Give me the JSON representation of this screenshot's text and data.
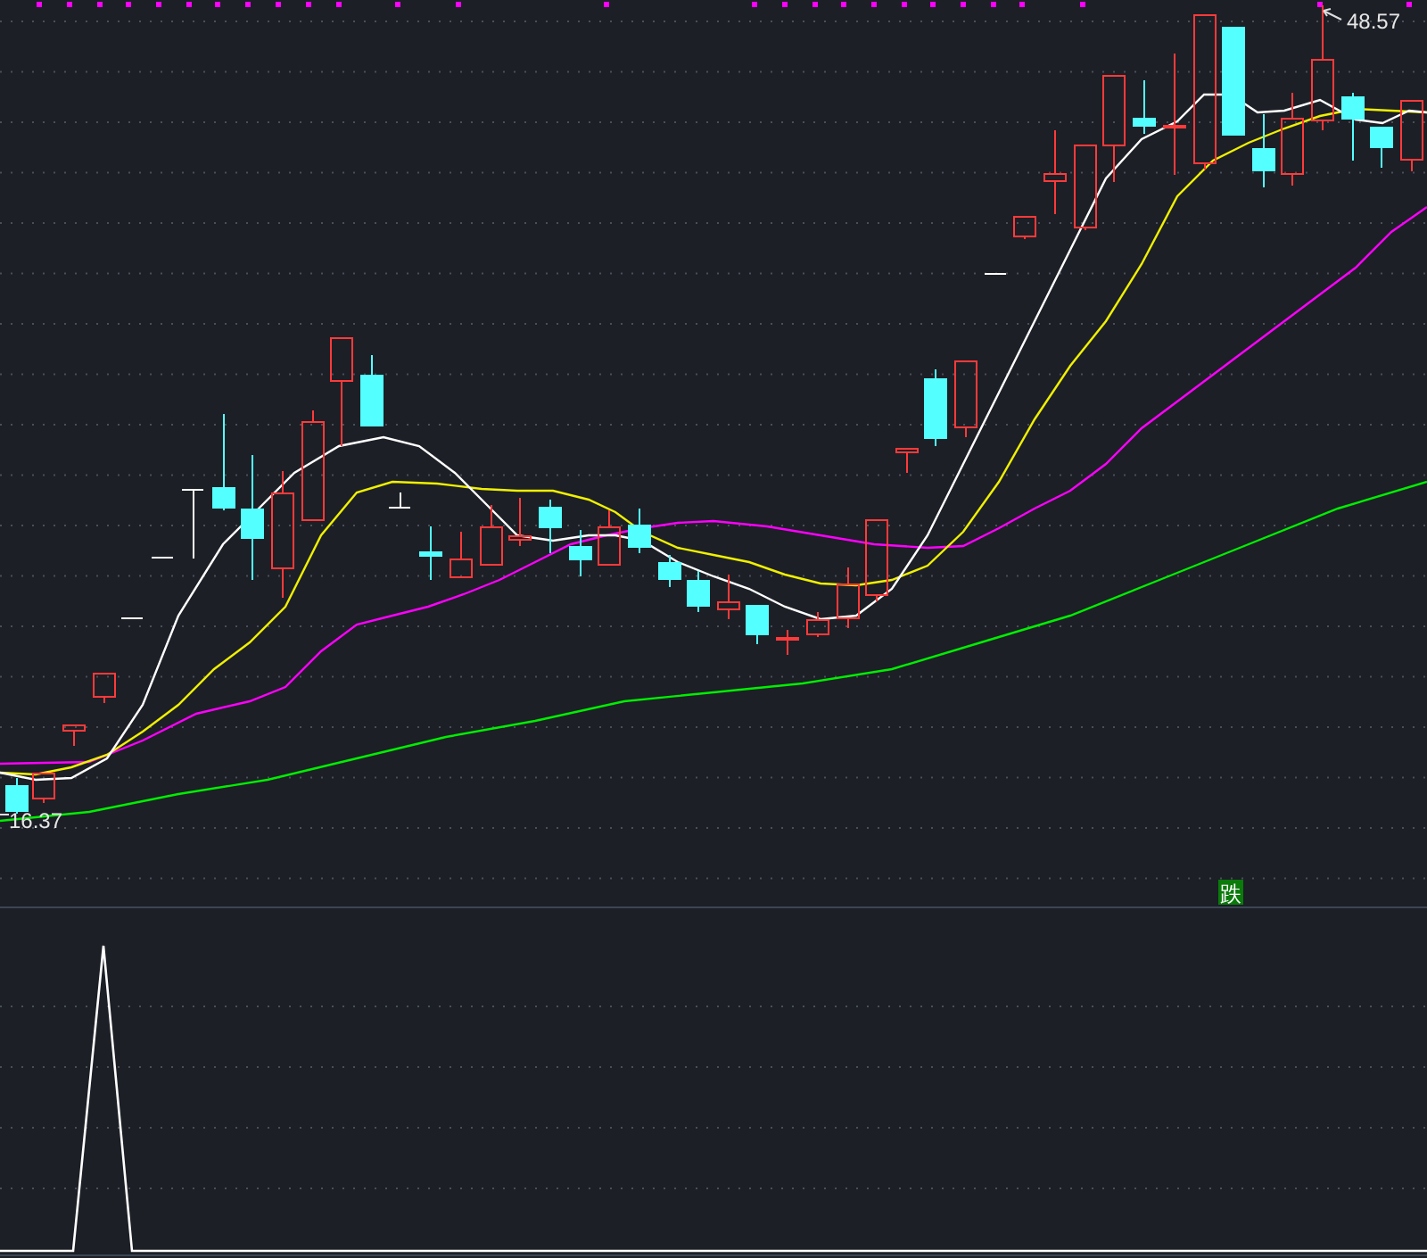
{
  "price_chart": {
    "high_label": "48.57",
    "low_label": "16.37"
  },
  "signal": {
    "label": "跌"
  }
}
